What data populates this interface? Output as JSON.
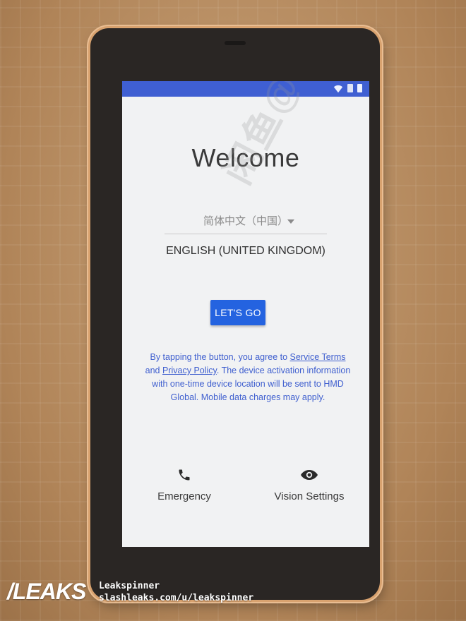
{
  "screen": {
    "title": "Welcome",
    "language_option_alt": "简体中文（中国）",
    "language_selected": "ENGLISH (UNITED KINGDOM)",
    "primary_button": "LET'S GO",
    "terms": {
      "part1": "By tapping the button, you agree to ",
      "service_terms": "Service Terms",
      "part2": " and ",
      "privacy_policy": "Privacy Policy",
      "part3": ". The device activation information with one-time device location will be sent to HMD Global. Mobile data charges may apply."
    },
    "emergency_label": "Emergency",
    "vision_label": "Vision Settings"
  },
  "watermark": {
    "logo": "/LEAKS",
    "user": "Leakspinner",
    "url": "slashleaks.com/u/leakspinner",
    "overlay": "闲鱼@c1074320245"
  },
  "colors": {
    "statusbar": "#3f5fd2",
    "accent": "#2463e0",
    "link": "#3f5fcf"
  }
}
